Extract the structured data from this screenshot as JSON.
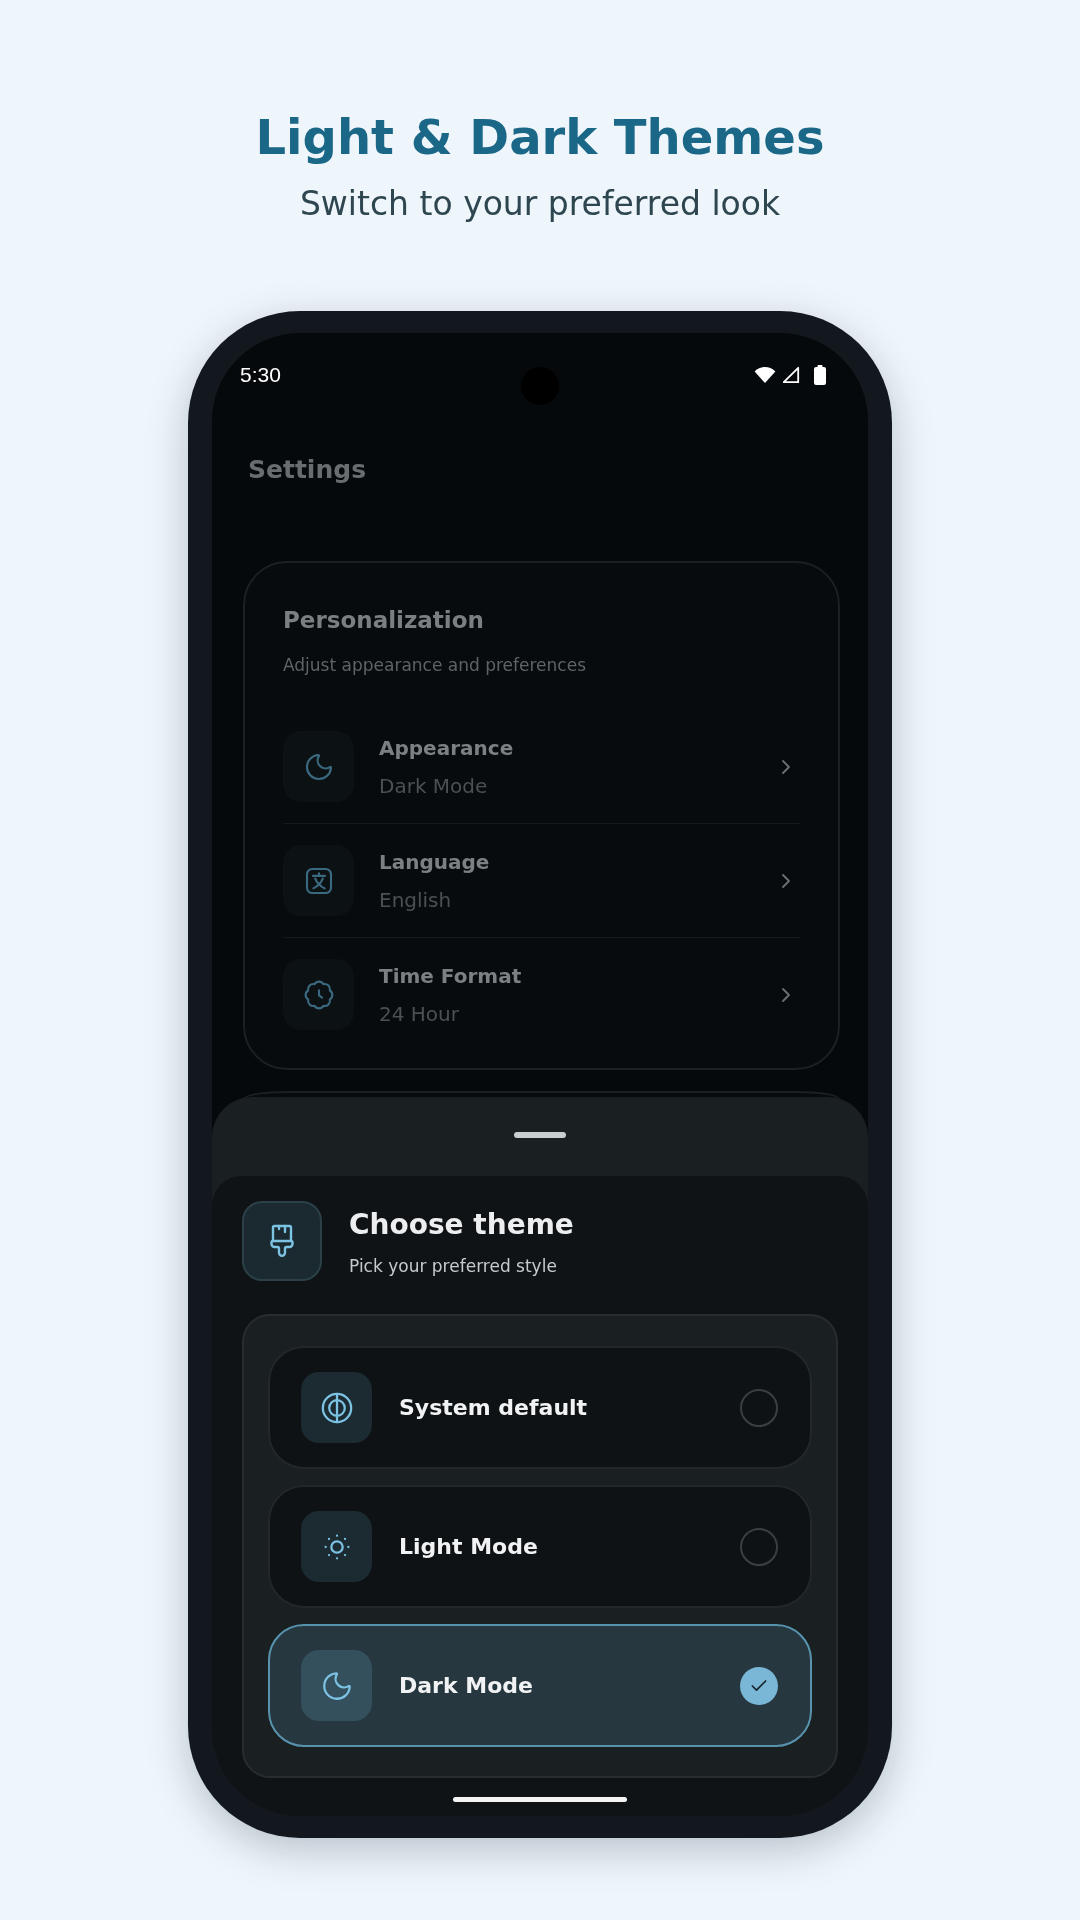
{
  "header": {
    "title": "Light & Dark Themes",
    "subtitle": "Switch to your preferred look"
  },
  "status_bar": {
    "time": "5:30"
  },
  "app_bar": {
    "title": "Settings"
  },
  "personalization": {
    "title": "Personalization",
    "subtitle": "Adjust appearance and preferences",
    "items": [
      {
        "label": "Appearance",
        "value": "Dark Mode"
      },
      {
        "label": "Language",
        "value": "English"
      },
      {
        "label": "Time Format",
        "value": "24 Hour"
      }
    ]
  },
  "theme_sheet": {
    "title": "Choose theme",
    "subtitle": "Pick your preferred style",
    "options": [
      {
        "label": "System default",
        "selected": false
      },
      {
        "label": "Light Mode",
        "selected": false
      },
      {
        "label": "Dark Mode",
        "selected": true
      }
    ]
  }
}
